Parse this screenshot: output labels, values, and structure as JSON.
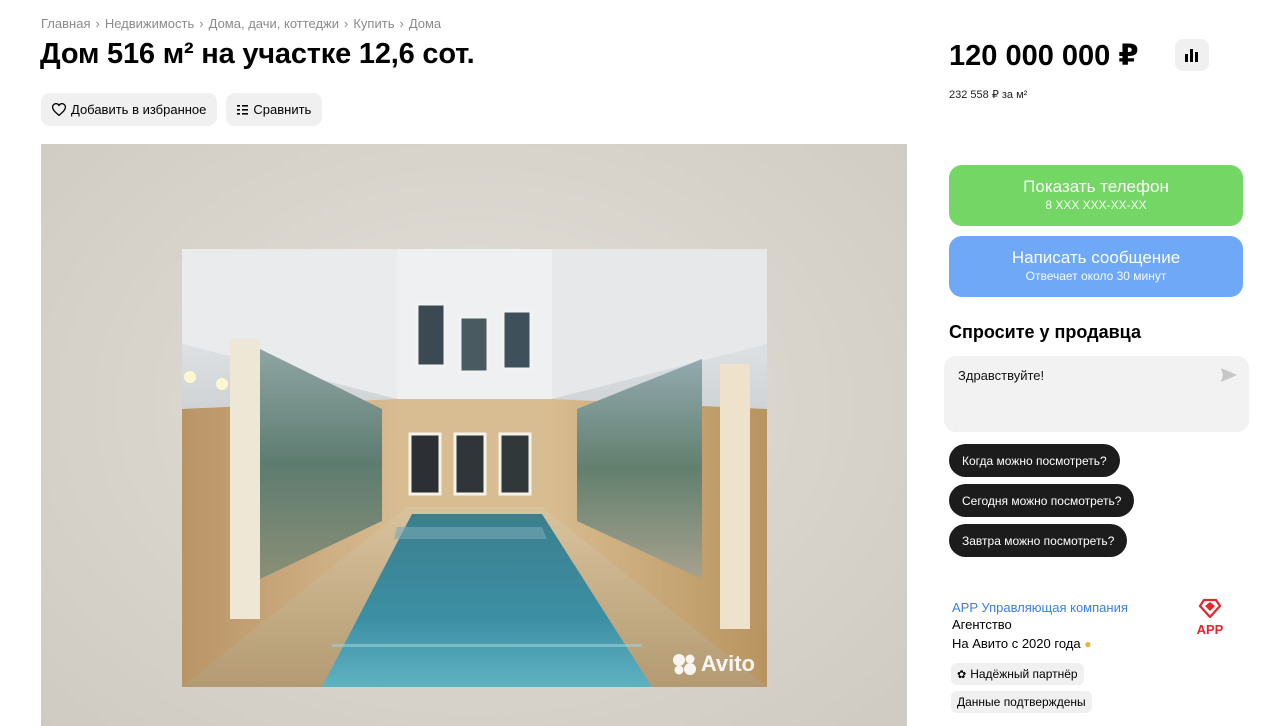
{
  "breadcrumb": [
    "Главная",
    "Недвижимость",
    "Дома, дачи, коттеджи",
    "Купить",
    "Дома"
  ],
  "breadcrumb_separator": "›",
  "title": "Дом 516 м² на участке 12,6 сот.",
  "actions": {
    "favorite_label": "Добавить в избранное",
    "compare_label": "Сравнить"
  },
  "gallery": {
    "watermark": "Avito"
  },
  "price": {
    "value": "120 000 000 ₽",
    "per_m2": "232 558 ₽ за м²",
    "stats_icon": "bar-chart-icon"
  },
  "contact": {
    "phone_label": "Показать телефон",
    "phone_sub": "8 XXX XXX-XX-XX",
    "message_label": "Написать сообщение",
    "message_sub": "Отвечает около 30 минут",
    "phone_color": "#74d765",
    "message_color": "#6fa8f6"
  },
  "ask": {
    "title": "Спросите у продавца",
    "input_value": "Здравствуйте!",
    "quick_questions": [
      "Когда можно посмотреть?",
      "Сегодня можно посмотреть?",
      "Завтра можно посмотреть?"
    ]
  },
  "seller": {
    "name": "APP Управляющая компания",
    "type": "Агентство",
    "since": "На Авито с 2020 года",
    "logo_text": "APP",
    "badges": [
      "Надёжный партнёр",
      "Данные подтверждены"
    ]
  }
}
